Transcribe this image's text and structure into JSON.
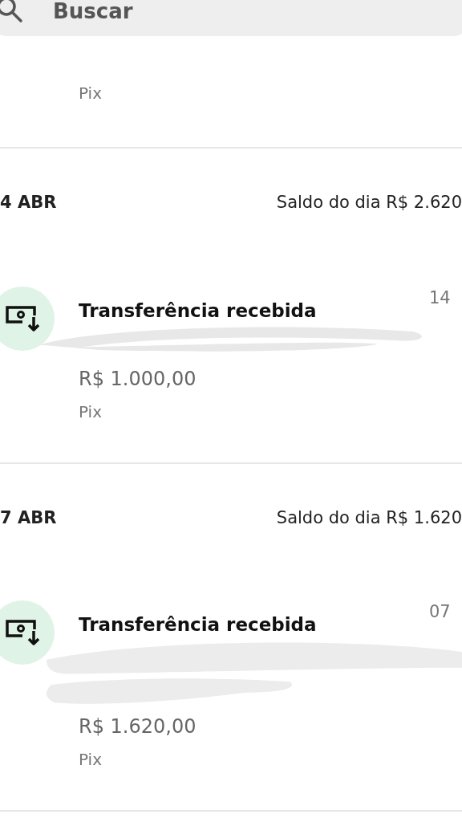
{
  "search": {
    "placeholder": "Buscar"
  },
  "top_item": {
    "method": "Pix"
  },
  "days": [
    {
      "date": "4 ABR",
      "balance": "Saldo do dia R$ 2.620",
      "transactions": [
        {
          "title": "Transferência recebida",
          "date": "14",
          "amount": "R$ 1.000,00",
          "method": "Pix"
        }
      ]
    },
    {
      "date": "7 ABR",
      "balance": "Saldo do dia R$ 1.620",
      "transactions": [
        {
          "title": "Transferência recebida",
          "date": "07",
          "amount": "R$ 1.620,00",
          "method": "Pix"
        }
      ]
    }
  ]
}
